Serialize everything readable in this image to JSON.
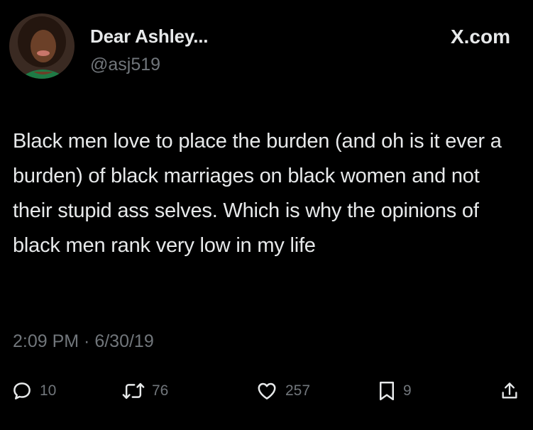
{
  "author": {
    "display_name": "Dear Ashley...",
    "handle": "@asj519"
  },
  "source_label": "X.com",
  "tweet": {
    "text": "Black men love to place the burden (and oh is it ever a burden) of black marriages on black women and not their stupid ass selves. Which is why the opinions of black men rank very low in my life",
    "timestamp": "2:09 PM · 6/30/19"
  },
  "actions": {
    "replies": "10",
    "retweets": "76",
    "likes": "257",
    "bookmarks": "9"
  },
  "icons": {
    "reply": "speech-bubble-icon",
    "retweet": "retweet-arrows-icon",
    "like": "heart-icon",
    "bookmark": "bookmark-icon",
    "share": "share-upload-icon"
  },
  "colors": {
    "background": "#000000",
    "text": "#e7e9ea",
    "secondary": "#71767b"
  }
}
